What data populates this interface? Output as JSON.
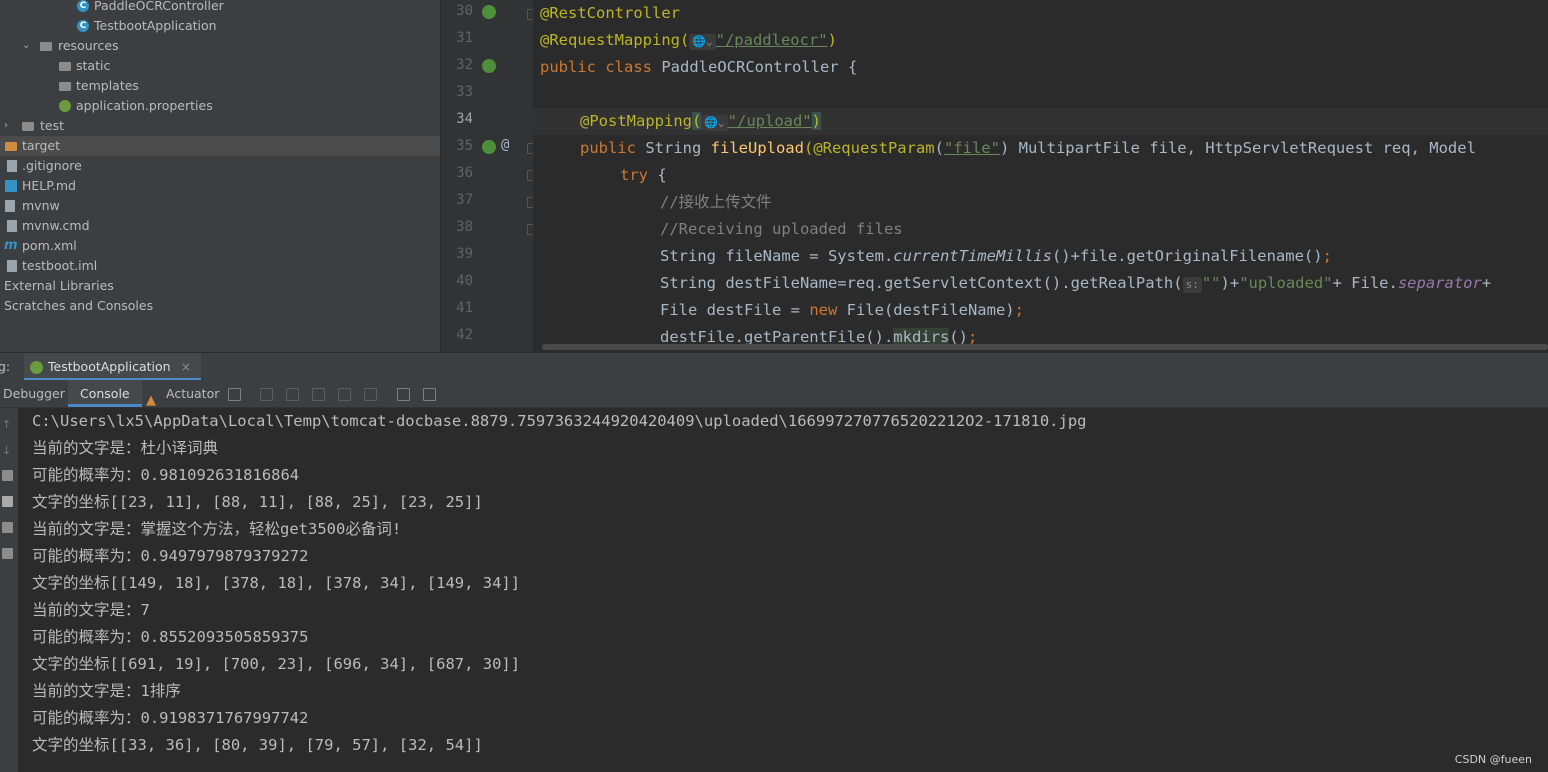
{
  "project_tree": {
    "items": [
      {
        "label": "PaddleOCRController",
        "icon": "java-class-icon"
      },
      {
        "label": "TestbootApplication",
        "icon": "java-class-icon"
      },
      {
        "label": "resources",
        "icon": "resources-folder-icon",
        "expanded": true
      },
      {
        "label": "static",
        "icon": "folder-icon"
      },
      {
        "label": "templates",
        "icon": "folder-icon"
      },
      {
        "label": "application.properties",
        "icon": "spring-properties-icon"
      },
      {
        "label": "test",
        "icon": "folder-icon",
        "expanded": false
      },
      {
        "label": "target",
        "icon": "excluded-folder-icon",
        "selected": true
      },
      {
        "label": ".gitignore",
        "icon": "file-icon"
      },
      {
        "label": "HELP.md",
        "icon": "markdown-icon"
      },
      {
        "label": "mvnw",
        "icon": "script-icon"
      },
      {
        "label": "mvnw.cmd",
        "icon": "file-icon"
      },
      {
        "label": "pom.xml",
        "icon": "maven-icon"
      },
      {
        "label": "testboot.iml",
        "icon": "file-icon"
      },
      {
        "label": "External Libraries",
        "icon": "library-icon"
      },
      {
        "label": "Scratches and Consoles",
        "icon": "scratch-icon"
      }
    ]
  },
  "editor": {
    "lines": [
      {
        "num": "30"
      },
      {
        "num": "31"
      },
      {
        "num": "32"
      },
      {
        "num": "33"
      },
      {
        "num": "34"
      },
      {
        "num": "35"
      },
      {
        "num": "36"
      },
      {
        "num": "37"
      },
      {
        "num": "38"
      },
      {
        "num": "39"
      },
      {
        "num": "40"
      },
      {
        "num": "41"
      },
      {
        "num": "42"
      }
    ],
    "code": {
      "l30_ann": "@RestController",
      "l31_ann": "@RequestMapping(",
      "l31_str": "\"/paddleocr\"",
      "l31_close": ")",
      "l32_kw": "public class ",
      "l32_name": "PaddleOCRController {",
      "l34_ann": "@PostMapping",
      "l34_open": "(",
      "l34_str": "\"/upload\"",
      "l34_close": ")",
      "l35_kw": "public ",
      "l35_type": "String ",
      "l35_fn": "fileUpload",
      "l35_ann": "(@RequestParam",
      "l35_p1": "(",
      "l35_str": "\"file\"",
      "l35_rest": ") MultipartFile file, HttpServletRequest req, Model",
      "l36_kw": "try",
      "l36_brace": " {",
      "l37_cmt": "//接收上传文件",
      "l38_cmt": "//Receiving uploaded files",
      "l39_a": "String fileName = System.",
      "l39_it": "currentTimeMillis",
      "l39_b": "()+file.getOriginalFilename()",
      "l39_semi": ";",
      "l40_a": "String destFileName=req.getServletContext().getRealPath(",
      "l40_hint": "s:",
      "l40_str1": "\"\"",
      "l40_b": ")+",
      "l40_str2": "\"uploaded\"",
      "l40_c": "+ File.",
      "l40_it": "separator",
      "l40_d": "+",
      "l41_a": "File destFile = ",
      "l41_kw": "new ",
      "l41_b": "File(destFileName)",
      "l41_semi": ";",
      "l42_a": "destFile.getParentFile().",
      "l42_m": "mkdirs",
      "l42_b": "()",
      "l42_semi": ";"
    },
    "url_hint_icon": "globe-icon"
  },
  "run_window": {
    "label_prefix": "g:",
    "config_tab": "TestbootApplication",
    "tabs": [
      "Debugger",
      "Console",
      "Actuator"
    ],
    "active_tab": "Console",
    "output": [
      "C:\\Users\\lx5\\AppData\\Local\\Temp\\tomcat-docbase.8879.7597363244920420409\\uploaded\\1669972707765202212O2-171810.jpg",
      "当前的文字是：杜小译词典",
      "可能的概率为：0.981092631816864",
      "文字的坐标[[23, 11], [88, 11], [88, 25], [23, 25]]",
      "当前的文字是：掌握这个方法，轻松get3500必备词!",
      "可能的概率为：0.9497979879379272",
      "文字的坐标[[149, 18], [378, 18], [378, 34], [149, 34]]",
      "当前的文字是：7",
      "可能的概率为：0.8552093505859375",
      "文字的坐标[[691, 19], [700, 23], [696, 34], [687, 30]]",
      "当前的文字是：1排序",
      "可能的概率为：0.9198371767997742",
      "文字的坐标[[33, 36], [80, 39], [79, 57], [32, 54]]"
    ]
  },
  "watermark": "CSDN @fueen",
  "colors": {
    "keyword": "#cc7832",
    "annotation": "#bbb529",
    "string": "#6a8759",
    "comment": "#808080",
    "method": "#ffc66d",
    "accent": "#4a88c7"
  }
}
